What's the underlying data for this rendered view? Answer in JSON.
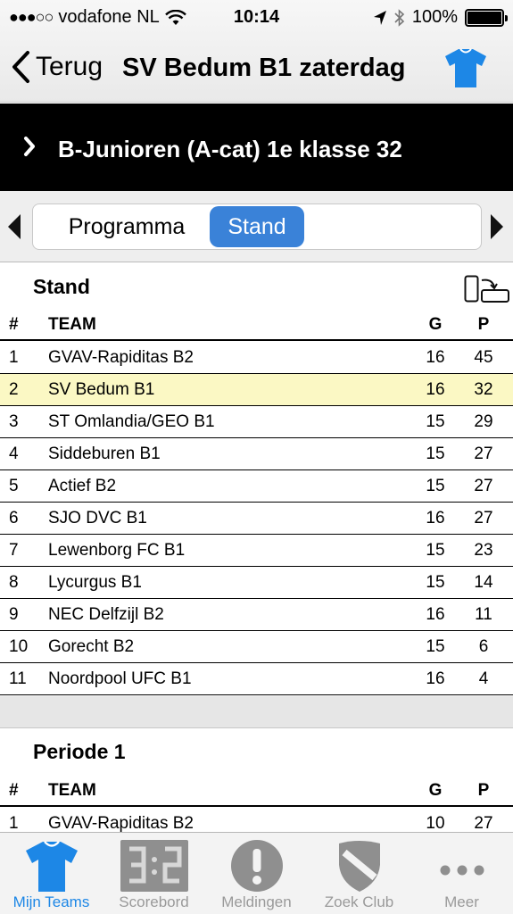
{
  "status": {
    "carrier": "vodafone NL",
    "time": "10:14",
    "battery": "100%"
  },
  "nav": {
    "back_label": "Terug",
    "title": "SV Bedum B1 zaterdag"
  },
  "league": {
    "label": "B-Junioren (A-cat) 1e klasse 32"
  },
  "segments": [
    "Programma",
    "Stand"
  ],
  "stand": {
    "title": "Stand",
    "headers": {
      "rank": "#",
      "team": "TEAM",
      "g": "G",
      "p": "P"
    },
    "rows": [
      {
        "rank": "1",
        "team": "GVAV-Rapiditas B2",
        "g": "16",
        "p": "45"
      },
      {
        "rank": "2",
        "team": "SV Bedum B1",
        "g": "16",
        "p": "32"
      },
      {
        "rank": "3",
        "team": "ST Omlandia/GEO B1",
        "g": "15",
        "p": "29"
      },
      {
        "rank": "4",
        "team": "Siddeburen B1",
        "g": "15",
        "p": "27"
      },
      {
        "rank": "5",
        "team": "Actief B2",
        "g": "15",
        "p": "27"
      },
      {
        "rank": "6",
        "team": "SJO DVC B1",
        "g": "16",
        "p": "27"
      },
      {
        "rank": "7",
        "team": "Lewenborg FC B1",
        "g": "15",
        "p": "23"
      },
      {
        "rank": "8",
        "team": "Lycurgus B1",
        "g": "15",
        "p": "14"
      },
      {
        "rank": "9",
        "team": "NEC Delfzijl B2",
        "g": "16",
        "p": "11"
      },
      {
        "rank": "10",
        "team": "Gorecht B2",
        "g": "15",
        "p": "6"
      },
      {
        "rank": "11",
        "team": "Noordpool UFC B1",
        "g": "16",
        "p": "4"
      }
    ]
  },
  "periode": {
    "title": "Periode 1",
    "headers": {
      "rank": "#",
      "team": "TEAM",
      "g": "G",
      "p": "P"
    },
    "rows": [
      {
        "rank": "1",
        "team": "GVAV-Rapiditas B2",
        "g": "10",
        "p": "27"
      }
    ]
  },
  "tabs": [
    {
      "label": "Mijn Teams",
      "icon": "shirt-icon"
    },
    {
      "label": "Scorebord",
      "icon": "scoreboard-icon"
    },
    {
      "label": "Meldingen",
      "icon": "alert-icon"
    },
    {
      "label": "Zoek Club",
      "icon": "shield-icon"
    },
    {
      "label": "Meer",
      "icon": "more-icon"
    }
  ],
  "colors": {
    "accent": "#1d87e6",
    "segment_active": "#3a82d8",
    "highlight_row": "#fbf8c4",
    "league_bar": "#000000"
  }
}
